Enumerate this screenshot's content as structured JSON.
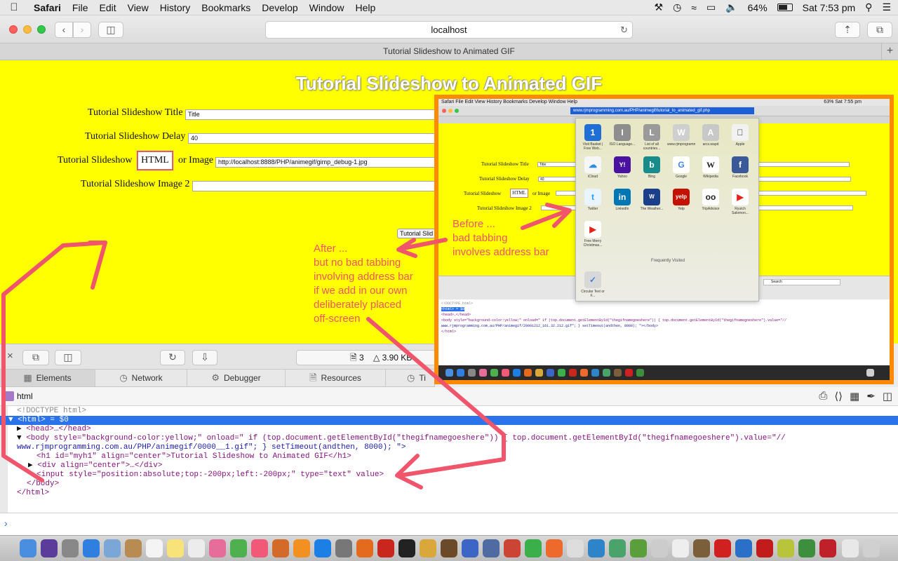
{
  "menubar": {
    "app": "Safari",
    "items": [
      "File",
      "Edit",
      "View",
      "History",
      "Bookmarks",
      "Develop",
      "Window",
      "Help"
    ],
    "battery": "64%",
    "clock": "Sat 7:53 pm"
  },
  "toolbar": {
    "address": "localhost"
  },
  "tab": {
    "title": "Tutorial Slideshow to Animated GIF"
  },
  "page": {
    "heading": "Tutorial Slideshow to Animated GIF",
    "title_label": "Tutorial Slideshow Title",
    "title_value": "Title",
    "delay_label": "Tutorial Slideshow Delay",
    "delay_value": "40",
    "slideshow_label": "Tutorial Slideshow",
    "html_button": "HTML",
    "or_image": "or Image",
    "image_value": "http://localhost:8888/PHP/animegif/gimp_debug-1.jpg",
    "image2_label": "Tutorial Slideshow Image 2",
    "submit_label": "Tutorial Slid"
  },
  "devtools": {
    "resource_count": "3",
    "resource_size": "3.90 KB",
    "tabs": [
      "Elements",
      "Network",
      "Debugger",
      "Resources",
      "Ti"
    ],
    "breadcrumb": "html",
    "dom_lines": {
      "doctype": "<!DOCTYPE html>",
      "html_open": "<html> = $0",
      "head": "<head>…</head>",
      "body_a": "<body style=\"background-color:yellow;\" onload=\" if (top.document.getElementById(\"thegifnamegoeshere\")) { top.document.getElementById(\"thegifnamegoeshere\").value=\"//",
      "body_b": "www.rjmprogramming.com.au/PHP/animegif/0000__1.gif\"; } setTimeout(andthen, 8000); \">",
      "h1": "<h1 id=\"myh1\" align=\"center\">Tutorial Slideshow to Animated GIF</h1>",
      "div": "<div align=\"center\">…</div>",
      "input": "<input style=\"position:absolute;top:-200px;left:-200px;\" type=\"text\" value>",
      "body_close": "</body>",
      "html_close": "</html>"
    }
  },
  "inset": {
    "menu": "Safari  File  Edit  View  History  Bookmarks  Develop  Window  Help",
    "status": "63%  Sat 7:55 pm",
    "address": "www.rjmprogramming.com.au/PHP/animegif/tutorial_to_animated_gif.php",
    "title_label": "Tutorial Slideshow Title",
    "title_value": "Title",
    "delay_label": "Tutorial Slideshow Delay",
    "delay_value": "40",
    "slideshow_label": "Tutorial Slideshow",
    "html_button": "HTML",
    "or_image": "or Image",
    "image2_label": "Tutorial Slideshow Image 2",
    "frequently_visited": "Frequently Visited",
    "tiles": [
      {
        "glyph": "1",
        "name": "Visit Basket | Free Web..."
      },
      {
        "glyph": "I",
        "name": "ISO Language..."
      },
      {
        "glyph": "L",
        "name": "List of all countries..."
      },
      {
        "glyph": "W",
        "name": "www.rjmprogrammi..."
      },
      {
        "glyph": "A",
        "name": "arcs.wapd"
      },
      {
        "glyph": "",
        "name": "Apple"
      },
      {
        "glyph": "☁",
        "name": "iCloud"
      },
      {
        "glyph": "Y!",
        "name": "Yahoo"
      },
      {
        "glyph": "b",
        "name": "Bing"
      },
      {
        "glyph": "G",
        "name": "Google"
      },
      {
        "glyph": "W",
        "name": "Wikipedia"
      },
      {
        "glyph": "f",
        "name": "Facebook"
      },
      {
        "glyph": "t",
        "name": "Twitter"
      },
      {
        "glyph": "in",
        "name": "LinkedIn"
      },
      {
        "glyph": "W",
        "name": "The Weather..."
      },
      {
        "glyph": "yelp",
        "name": "Yelp"
      },
      {
        "glyph": "oo",
        "name": "TripAdvisor"
      },
      {
        "glyph": "▶",
        "name": "Ryutch Salomon..."
      },
      {
        "glyph": "▶",
        "name": "Free Merry Christmas..."
      }
    ],
    "circular": "Circular Text or F...",
    "dom_line1": "<!DOCTYPE html>",
    "dom_line2": "<html> = $0",
    "dom_line3": "<head>…</head>",
    "dom_line4": "<body style=\"background-color:yellow;\" onload=\" if (top.document.getElementById(\"thegifnamegoeshere\")) { top.document.getElementById(\"thegifnamegoeshere\").value=\"//",
    "dom_line5": "www.rjmprogramming.com.au/PHP/animegif/20001212_161.32.212.gif\"; } setTimeout(andthen, 8000); \"></body>",
    "dom_line6": "</html>",
    "search": "Search"
  },
  "annotations": {
    "before": [
      "Before ...",
      "bad tabbing",
      "involves address bar"
    ],
    "after": [
      "After ...",
      "but no bad tabbing",
      "involving address bar",
      "if we add in our own",
      "deliberately placed",
      "off-screen"
    ]
  },
  "colors": {
    "page_bg": "#ffff00",
    "annotation": "#f0556b",
    "inset_border": "#ff8a00",
    "selection": "#2b73ea"
  }
}
